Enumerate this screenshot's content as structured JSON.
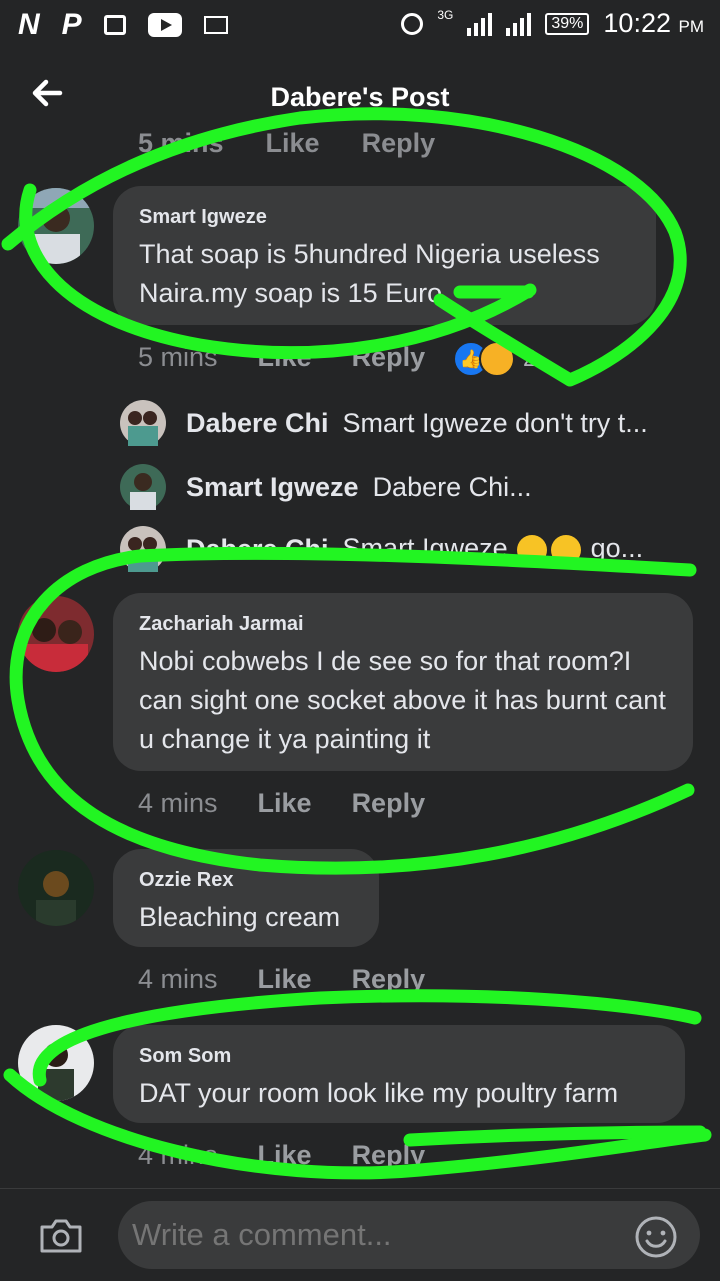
{
  "status_bar": {
    "left_glyphs": [
      "N",
      "P"
    ],
    "network": "3G",
    "battery": "39%",
    "time": "10:22",
    "ampm": "PM"
  },
  "header": {
    "title": "Dabere's Post"
  },
  "previous_meta": {
    "time": "5 mins",
    "like": "Like",
    "reply": "Reply"
  },
  "comments": [
    {
      "author": "Smart Igweze",
      "text": "That soap is 5hundred Nigeria useless Naira.my soap is 15 Euro",
      "time": "5 mins",
      "like": "Like",
      "reply": "Reply",
      "reaction_count": "2"
    },
    {
      "author": "Zachariah Jarmai",
      "text": "Nobi cobwebs I de see so for that room?I can sight one socket above it has burnt cant u change it ya painting it",
      "time": "4 mins",
      "like": "Like",
      "reply": "Reply"
    },
    {
      "author": "Ozzie Rex",
      "text": "Bleaching cream",
      "time": "4 mins",
      "like": "Like",
      "reply": "Reply"
    },
    {
      "author": "Som Som",
      "text": "DAT your room look like my poultry farm",
      "time": "4 mins",
      "like": "Like",
      "reply": "Reply"
    }
  ],
  "replies": [
    {
      "name": "Dabere Chi",
      "snippet": "Smart Igweze don't  try t..."
    },
    {
      "name": "Smart Igweze",
      "snippet": "Dabere Chi..."
    },
    {
      "name": "Dabere Chi",
      "snippet_pre": "Smart Igweze",
      "snippet_post": "go..."
    }
  ],
  "composer": {
    "placeholder": "Write a comment..."
  },
  "colors": {
    "background": "#242526",
    "bubble": "#3a3b3c",
    "annotation": "#22f522",
    "like_blue": "#1877f2"
  }
}
